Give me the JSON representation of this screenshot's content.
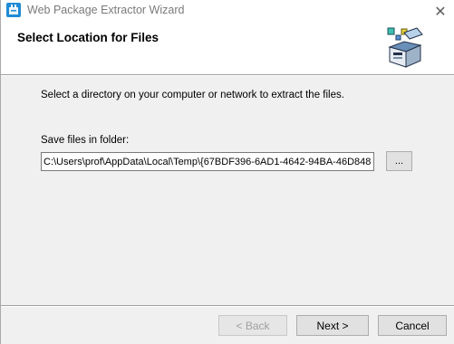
{
  "window": {
    "title": "Web Package Extractor Wizard",
    "close_glyph": "✕",
    "app_icon": "package-extractor-icon"
  },
  "header": {
    "title": "Select Location for Files",
    "graphic_icon": "package-box-icon"
  },
  "content": {
    "description": "Select a directory on your computer or network to extract the files.",
    "folder_label": "Save files in folder:",
    "folder_value": "C:\\Users\\prof\\AppData\\Local\\Temp\\{67BDF396-6AD1-4642-94BA-46D848",
    "browse_label": "..."
  },
  "footer": {
    "back_label": "< Back",
    "next_label": "Next >",
    "cancel_label": "Cancel"
  },
  "colors": {
    "dialog_bg": "#f0f0f0",
    "header_bg": "#ffffff",
    "icon_blue": "#1e8bd6",
    "disabled_text": "#a0a0a0"
  }
}
